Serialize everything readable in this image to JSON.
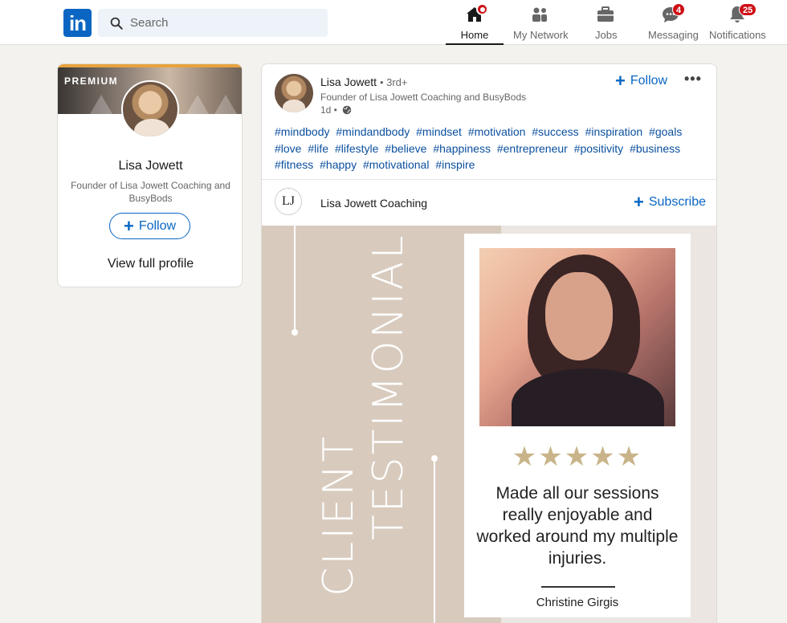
{
  "nav": {
    "search_placeholder": "Search",
    "items": [
      {
        "label": "Home",
        "icon": "home-icon",
        "badge": ""
      },
      {
        "label": "My Network",
        "icon": "network-icon",
        "badge": ""
      },
      {
        "label": "Jobs",
        "icon": "briefcase-icon",
        "badge": ""
      },
      {
        "label": "Messaging",
        "icon": "messaging-icon",
        "badge": "4"
      },
      {
        "label": "Notifications",
        "icon": "bell-icon",
        "badge": "25"
      }
    ]
  },
  "profile": {
    "premium": "PREMIUM",
    "name": "Lisa Jowett",
    "headline": "Founder of Lisa Jowett Coaching and BusyBods",
    "follow": "Follow",
    "view_profile": "View full profile"
  },
  "post": {
    "author": "Lisa Jowett",
    "degree": "• 3rd+",
    "headline": "Founder of Lisa Jowett Coaching and BusyBods",
    "time": "1d •",
    "follow": "Follow",
    "more": "•••",
    "hashtags": [
      "#mindbody",
      "#mindandbody",
      "#mindset",
      "#motivation",
      "#success",
      "#inspiration",
      "#goals",
      "#love",
      "#life",
      "#lifestyle",
      "#believe",
      "#happiness",
      "#entrepreneur",
      "#positivity",
      "#business",
      "#fitness",
      "#happy",
      "#motivational",
      "#inspire"
    ],
    "newsletter_logo": "LJ",
    "newsletter": "Lisa Jowett Coaching",
    "subscribe": "Subscribe"
  },
  "testimonial": {
    "vertical_1": "TESTIMONIAL",
    "vertical_2": "CLIENT",
    "stars": "★★★★★",
    "rating": 5,
    "quote": "Made all our sessions really enjoyable and worked around my multiple injuries.",
    "signature": "Christine Girgis"
  },
  "colors": {
    "brand": "#0a66c2",
    "badge": "#cc1016",
    "hashtag": "#0a4f9e",
    "image_bg": "#d8cbbe",
    "star": "#c9b48a"
  }
}
